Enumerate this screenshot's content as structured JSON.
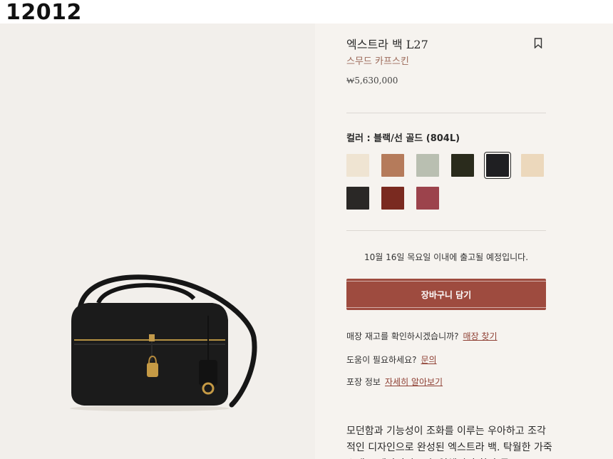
{
  "page_id": "12012",
  "product": {
    "title": "엑스트라 백 L27",
    "subtitle": "스무드 카프스킨",
    "price": "₩5,630,000"
  },
  "color": {
    "label": "컬러 : 블랙/선 골드 (804L)",
    "swatches": [
      {
        "color": "#efe4d2",
        "selected": false
      },
      {
        "color": "#b57b5b",
        "selected": false
      },
      {
        "color": "#b9bfb1",
        "selected": false
      },
      {
        "color": "#2a2b1c",
        "selected": false
      },
      {
        "color": "#1f1f22",
        "selected": true
      },
      {
        "color": "#ecd8bc",
        "selected": false
      },
      {
        "color": "#2a2826",
        "selected": false
      },
      {
        "color": "#7a2a20",
        "selected": false
      },
      {
        "color": "#9c434c",
        "selected": false
      }
    ]
  },
  "shipping": "10월 16일 목요일 이내에 출고될 예정입니다.",
  "cart_button": "장바구니 담기",
  "store": {
    "text": "매장 재고를 확인하시겠습니까?",
    "link": "매장 찾기"
  },
  "help": {
    "text": "도움이 필요하세요?",
    "link": "문의"
  },
  "packaging": {
    "text": "포장 정보",
    "link": "자세히 알아보기"
  },
  "description": "모던함과 기능성이 조화를 이루는 우아하고 조각적인 디자인으로 완성된 엑스트라 백. 탁월한 가죽 소재로 제작되었으며, 입체적인 착과 동"
}
